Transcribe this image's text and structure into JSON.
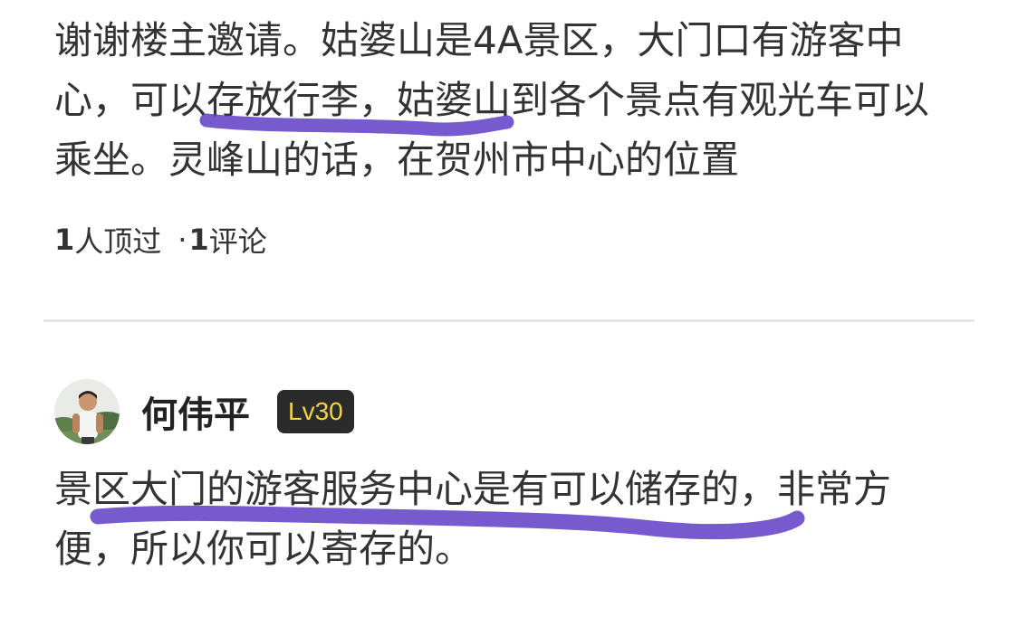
{
  "answers": [
    {
      "text": "谢谢楼主邀请。姑婆山是4A景区，大门口有游客中心，可以存放行李，姑婆山到各个景点有观光车可以乘坐。灵峰山的话，在贺州市中心的位置",
      "likes": "1",
      "likes_label": "人顶过",
      "separator": "·",
      "comments": "1",
      "comments_label": "评论"
    },
    {
      "author": {
        "name": "何伟平",
        "level": "Lv30"
      },
      "text": "景区大门的游客服务中心是有可以储存的，非常方便，所以你可以寄存的。"
    }
  ],
  "colors": {
    "highlight": "#5f3dc4",
    "badge_bg": "#2b2b2b",
    "badge_text": "#f3d34a",
    "divider": "#e6e6e6"
  }
}
